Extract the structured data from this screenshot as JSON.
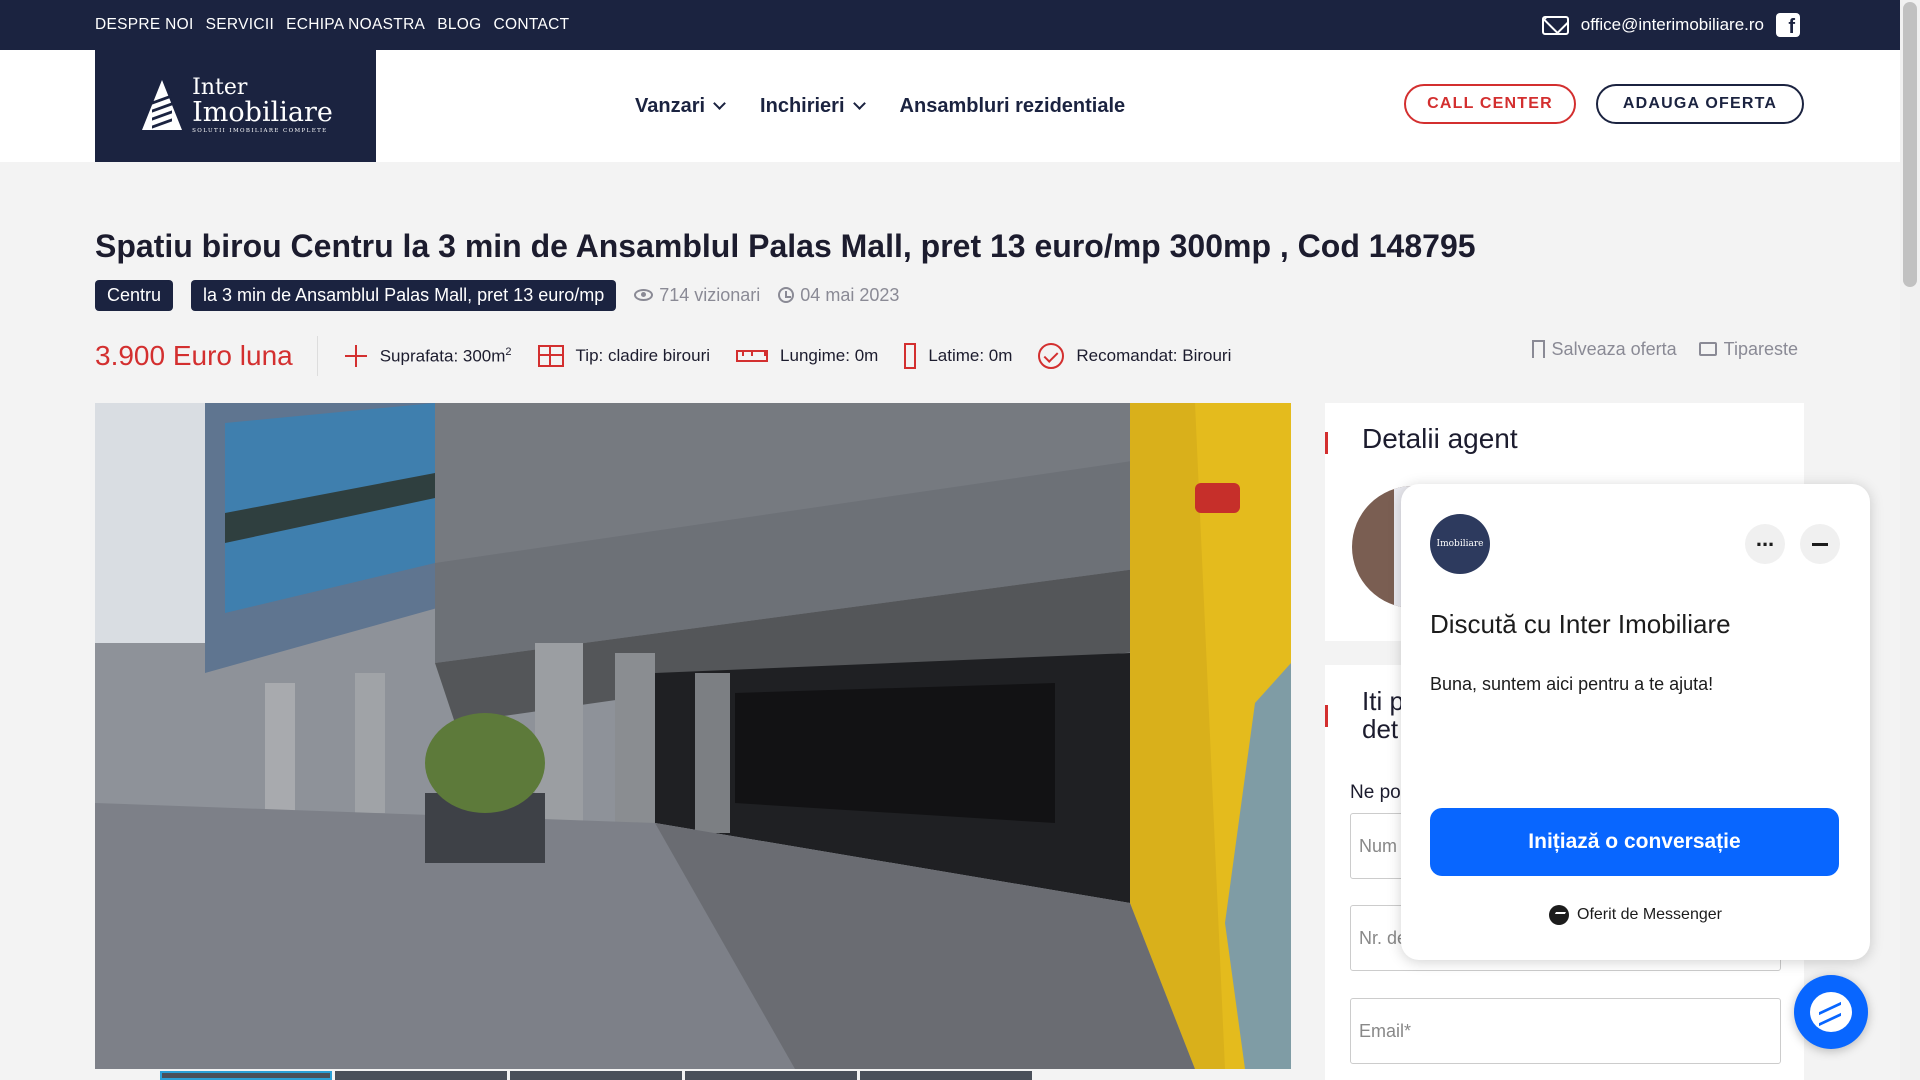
{
  "topbar": {
    "nav": [
      "DESPRE NOI",
      "SERVICII",
      "ECHIPA NOASTRA",
      "BLOG",
      "CONTACT"
    ],
    "email": "office@interimobiliare.ro",
    "email_icon": "mail-icon",
    "social_icon": "facebook-icon"
  },
  "header": {
    "logo": {
      "line1": "Inter",
      "line2": "Imobiliare",
      "tagline": "SOLUTII IMOBILIARE COMPLETE"
    },
    "nav": [
      {
        "label": "Vanzari",
        "dropdown": true
      },
      {
        "label": "Inchirieri",
        "dropdown": true
      },
      {
        "label": "Ansambluri rezidentiale",
        "dropdown": false
      }
    ],
    "call_center": "CALL CENTER",
    "add_offer": "ADAUGA OFERTA"
  },
  "listing": {
    "title": "Spatiu birou Centru la 3 min de Ansamblul Palas Mall, pret 13 euro/mp 300mp , Cod 148795",
    "tags": [
      "Centru",
      "la 3 min de Ansamblul Palas Mall, pret 13 euro/mp"
    ],
    "views": "714 vizionari",
    "date": "04 mai 2023",
    "price": "3.900 Euro luna",
    "specs": {
      "surface_label": "Suprafata: 300m",
      "surface_sup": "2",
      "type": "Tip: cladire birouri",
      "length": "Lungime: 0m",
      "width": "Latime: 0m",
      "recommended": "Recomandat: Birouri"
    },
    "save": "Salveaza oferta",
    "print": "Tipareste"
  },
  "sidebar": {
    "agent_title": "Detalii agent",
    "contact_title_partial": [
      "Iti p",
      "det"
    ],
    "contact_intro_partial": "Ne po",
    "fields": [
      "Num",
      "Nr. de",
      "Email*"
    ]
  },
  "messenger": {
    "title": "Discută cu Inter Imobiliare",
    "message": "Buna, suntem aici pentru a te ajuta!",
    "cta": "Inițiază o conversație",
    "footer": "Oferit de Messenger",
    "brand_color": "#0866ff"
  },
  "colors": {
    "navy": "#1b2340",
    "accent_red": "#d32f2f"
  }
}
